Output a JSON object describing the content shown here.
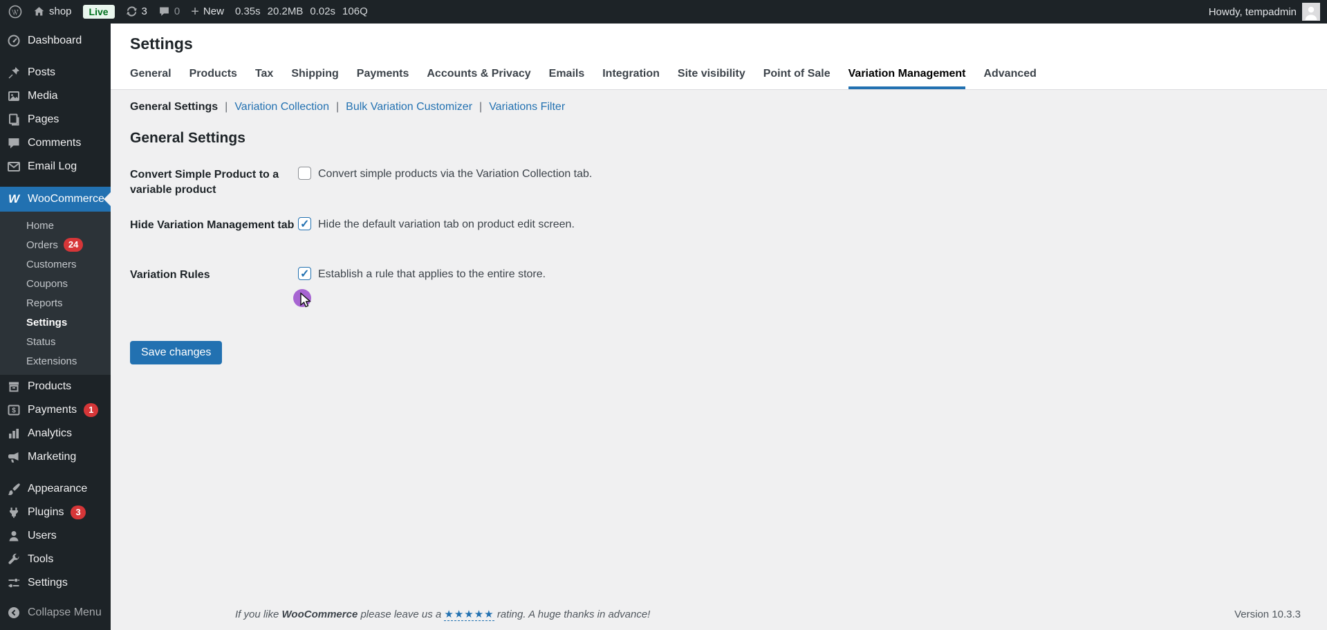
{
  "admin_bar": {
    "site_name": "shop",
    "live_badge": "Live",
    "updates_count": "3",
    "comments_count": "0",
    "new_label": "New",
    "stats": {
      "time": "0.35s",
      "memory": "20.2MB",
      "query_time": "0.02s",
      "queries": "106Q"
    },
    "howdy": "Howdy, tempadmin"
  },
  "sidebar": {
    "dashboard": "Dashboard",
    "posts": "Posts",
    "media": "Media",
    "pages": "Pages",
    "comments": "Comments",
    "email_log": "Email Log",
    "woocommerce": "WooCommerce",
    "woo_submenu": {
      "home": "Home",
      "orders": "Orders",
      "orders_badge": "24",
      "customers": "Customers",
      "coupons": "Coupons",
      "reports": "Reports",
      "settings": "Settings",
      "status": "Status",
      "extensions": "Extensions"
    },
    "products": "Products",
    "payments": "Payments",
    "payments_badge": "1",
    "analytics": "Analytics",
    "marketing": "Marketing",
    "appearance": "Appearance",
    "plugins": "Plugins",
    "plugins_badge": "3",
    "users": "Users",
    "tools": "Tools",
    "settings": "Settings",
    "collapse": "Collapse Menu"
  },
  "page": {
    "title": "Settings",
    "tabs": [
      "General",
      "Products",
      "Tax",
      "Shipping",
      "Payments",
      "Accounts & Privacy",
      "Emails",
      "Integration",
      "Site visibility",
      "Point of Sale",
      "Variation Management",
      "Advanced"
    ],
    "active_tab": "Variation Management",
    "subnav": [
      "General Settings",
      "Variation Collection",
      "Bulk Variation Customizer",
      "Variations Filter"
    ],
    "section_title": "General Settings",
    "rows": [
      {
        "label": "Convert Simple Product to a variable product",
        "checked": false,
        "description": "Convert simple products via the Variation Collection tab."
      },
      {
        "label": "Hide Variation Management tab",
        "checked": true,
        "description": "Hide the default variation tab on product edit screen."
      },
      {
        "label": "Variation Rules",
        "checked": true,
        "description": "Establish a rule that applies to the entire store."
      }
    ],
    "save_button": "Save changes"
  },
  "footer": {
    "prefix": "If you like",
    "brand": "WooCommerce",
    "middle": "please leave us a",
    "stars": "★★★★★",
    "suffix": "rating. A huge thanks in advance!",
    "version": "Version 10.3.3"
  },
  "colors": {
    "accent": "#2271b1",
    "badge_red": "#d63638",
    "live_bg": "#e9f6ee",
    "live_text": "#00701c",
    "cursor_highlight": "#a765d2"
  }
}
